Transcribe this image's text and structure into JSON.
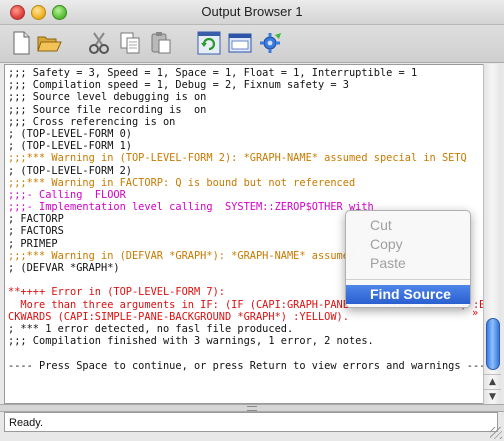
{
  "window": {
    "title": "Output Browser 1"
  },
  "toolbar": {
    "buttons": [
      {
        "name": "new-document-icon"
      },
      {
        "name": "open-folder-icon"
      },
      {
        "name": "cut-icon"
      },
      {
        "name": "copy-icon"
      },
      {
        "name": "paste-icon"
      },
      {
        "name": "refresh-icon"
      },
      {
        "name": "window-icon"
      },
      {
        "name": "gear-settings-icon"
      }
    ]
  },
  "output": {
    "lines": [
      {
        "text": ";;; Safety = 3, Speed = 1, Space = 1, Float = 1, Interruptible = 1",
        "color": "black"
      },
      {
        "text": ";;; Compilation speed = 1, Debug = 2, Fixnum safety = 3",
        "color": "black"
      },
      {
        "text": ";;; Source level debugging is on",
        "color": "black"
      },
      {
        "text": ";;; Source file recording is  on",
        "color": "black"
      },
      {
        "text": ";;; Cross referencing is on",
        "color": "black"
      },
      {
        "text": "; (TOP-LEVEL-FORM 0)",
        "color": "black"
      },
      {
        "text": "; (TOP-LEVEL-FORM 1)",
        "color": "black"
      },
      {
        "text": ";;;*** Warning in (TOP-LEVEL-FORM 2): *GRAPH-NAME* assumed special in SETQ",
        "color": "orange"
      },
      {
        "text": "; (TOP-LEVEL-FORM 2)",
        "color": "black"
      },
      {
        "text": ";;;*** Warning in FACTORP: Q is bound but not referenced",
        "color": "orange"
      },
      {
        "text": ";;;- Calling  FLOOR",
        "color": "magenta"
      },
      {
        "text": ";;;- Implementation level calling  SYSTEM::ZEROP$OTHER with",
        "color": "magenta"
      },
      {
        "text": "; FACTORP",
        "color": "black"
      },
      {
        "text": "; FACTORS",
        "color": "black"
      },
      {
        "text": "; PRIMEP",
        "color": "black"
      },
      {
        "text": ";;;*** Warning in (DEFVAR *GRAPH*): *GRAPH-NAME* assumed",
        "color": "orange"
      },
      {
        "text": "; (DEFVAR *GRAPH*)",
        "color": "black"
      },
      {
        "text": "",
        "color": "black"
      },
      {
        "text": "**++++ Error in (TOP-LEVEL-FORM 7):",
        "color": "red"
      },
      {
        "text": "  More than three arguments in IF: (IF (CAPI:GRAPH-PANE-DIRECTION *GRAPH*) :BA",
        "color": "red"
      },
      {
        "text": "CKWARDS (CAPI:SIMPLE-PANE-BACKGROUND *GRAPH*) :YELLOW).",
        "color": "red"
      },
      {
        "text": "; *** 1 error detected, no fasl file produced.",
        "color": "black"
      },
      {
        "text": ";;; Compilation finished with 3 warnings, 1 error, 2 notes.",
        "color": "black"
      },
      {
        "text": "",
        "color": "black"
      },
      {
        "text": "---- Press Space to continue, or press Return to view errors and warnings ----",
        "color": "black"
      }
    ],
    "overflow_marker": "»"
  },
  "context_menu": {
    "items": [
      {
        "label": "Cut",
        "enabled": false
      },
      {
        "label": "Copy",
        "enabled": false
      },
      {
        "label": "Paste",
        "enabled": false
      },
      {
        "label": "Find Source",
        "enabled": true,
        "highlighted": true
      }
    ]
  },
  "status": {
    "text": "Ready."
  },
  "colors": {
    "black": "#111111",
    "orange": "#c87a00",
    "magenta": "#d400c8",
    "red": "#dd1010",
    "highlight": "#2a5fd0"
  }
}
